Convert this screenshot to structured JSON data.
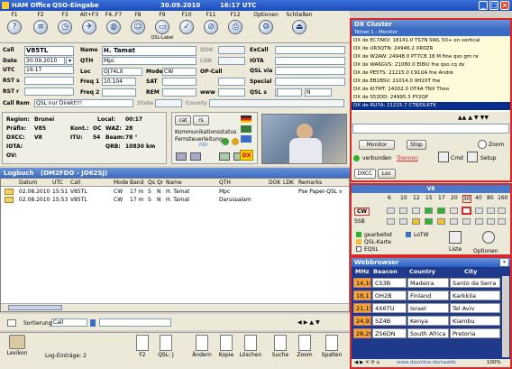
{
  "window": {
    "title": "HAM Office",
    "subtitle": "QSO-Eingabe",
    "date": "30.09.2010",
    "time": "16:17 UTC"
  },
  "toolbar": [
    {
      "key": "F1",
      "icon": "help-icon",
      "glyph": "?"
    },
    {
      "key": "F2",
      "icon": "log-icon",
      "glyph": "≡"
    },
    {
      "key": "F3",
      "icon": "clock-icon",
      "glyph": "◷"
    },
    {
      "key": "Alt+F3",
      "icon": "satellite-icon",
      "glyph": "✈"
    },
    {
      "key": "F4..F7",
      "icon": "globe-icon",
      "glyph": "◍"
    },
    {
      "key": "F8",
      "icon": "person-icon",
      "glyph": "☺"
    },
    {
      "key": "F9",
      "icon": "qsl-label-icon",
      "glyph": "▭",
      "label": "QSL-Label"
    },
    {
      "key": "F10",
      "icon": "check-icon",
      "glyph": "✓"
    },
    {
      "key": "F11",
      "icon": "cancel-icon",
      "glyph": "⊘"
    },
    {
      "key": "F12",
      "icon": "print-icon",
      "glyph": "⎙"
    },
    {
      "key": "Optionen",
      "icon": "options-icon",
      "glyph": "⚙"
    },
    {
      "key": "Schließen",
      "icon": "exit-icon",
      "glyph": "⏏"
    }
  ],
  "form": {
    "call_label": "Call",
    "call": "V85TL",
    "date_label": "Date",
    "date": "30.09.2010",
    "utc_label": "UTC",
    "utc": "16:17",
    "rst_s_label": "RST s",
    "rst_r_label": "RST r",
    "name_label": "Name",
    "name": "H. Tamat",
    "qth_label": "QTH",
    "qth": "Mpc",
    "loc_label": "Loc",
    "loc": "OJ74LX",
    "freq_label": "Freq 1",
    "freq": "10.104",
    "freq2_label": "Freq 2",
    "mode_label": "Mode",
    "mode": "CW",
    "sat_label": "SAT",
    "rem_label": "REM",
    "www_label": "www",
    "dok_label": "DOK",
    "ldk_label": "LDK",
    "excall_label": "ExCall",
    "iota_label": "IOTA",
    "qsl_via_label": "QSL via",
    "opcall_label": "OP-Call",
    "special_label": "Special",
    "qsl_s_label": "QSL s",
    "qsl_s_value": "J",
    "qsl_s_value2": "N",
    "state_label": "State",
    "county_label": "County",
    "call_rem_label": "Call Rem",
    "call_rem": "QSL nur Direkt!!!"
  },
  "info": {
    "region_label": "Region:",
    "region": "Brunei",
    "prefix_label": "Präfix:",
    "prefix": "V85",
    "dxcc_label": "DXCC:",
    "dxcc": "V8",
    "iota_label": "IOTA:",
    "ov_label": "OV:",
    "local_label": "Local:",
    "local": "00:17",
    "kont_label": "Kont.:",
    "kont": "OC",
    "itu_label": "ITU:",
    "itu": "54",
    "qrb_label": "QRB:",
    "qrb": "10830 km",
    "waz_label": "WAZ:",
    "waz": "28",
    "beam_label": "Beam:",
    "beam": "78 °",
    "tab_cat": "cat",
    "tab_rs": "rs",
    "kommunikation": "Kommunikationsstatus",
    "fernsteuer": "Fernsteuerleitung:",
    "fernsteuer_val": "nin",
    "dx_badge": "DX"
  },
  "log": {
    "title": "Logbuch",
    "subtitle": "(DM2FDO - JO62SJ)",
    "columns": [
      "Datum",
      "UTC",
      "Call",
      "Mode",
      "Band",
      "Qs",
      "Qr",
      "Name",
      "QTH",
      "DOK",
      "LDK",
      "Remarks"
    ],
    "rows": [
      [
        "02.08.2010",
        "15:51",
        "V85TL",
        "CW",
        "17 m",
        "S",
        "N",
        "H. Tamat",
        "Mpc",
        "",
        "",
        "Pse Paper-QSL v"
      ],
      [
        "02.08.2010",
        "15:53",
        "V85TL",
        "CW",
        "17 m",
        "S",
        "N",
        "H. Tamat",
        "Darussalam",
        "",
        "",
        ""
      ]
    ]
  },
  "sortbar": {
    "label": "Sortierung:",
    "value": "Call"
  },
  "bottom": {
    "lexikon": "Lexikon",
    "entries": "Log-Einträge: 2",
    "buttons": [
      "F2",
      "QSL: J",
      "Ändern",
      "Kopie",
      "Löschen",
      "Suche",
      "Zoom",
      "Spalten"
    ]
  },
  "dxcluster": {
    "title": "DX Cluster",
    "connection": "Telnet 1 - Monitor",
    "spots": [
      "DX de EC7AKV:  18141.0  TS7N   SWL 50+ on vertical",
      "DX de UR3QTN:  24946.2  XR0ZR",
      "DX de W2AW:   24948.0  PT7CB   18 M   fine qso gm ra",
      "DX de WA6GVS: 21080.0  EI8IU          fne qso cq dx",
      "DX de PE5TS:  21215.0  C91UA          fne André",
      "DX de EB1BSV: 21014.0  9H2XT   fne",
      "DX de KI7MT:  14202.0  OT4A   TNX Theo",
      "DX de S52DD:  24995.3  PY2QP",
      "DX de RU7A:   21215.7  CT8/DL6TK"
    ],
    "monitor": "Monitor",
    "stop": "Stop",
    "zoom": "Zoom",
    "status": "verbunden",
    "disconnect": "Trennen",
    "cmd": "Cmd",
    "setup": "Setup",
    "tab_dxcc": "DXCC",
    "tab_loc": "Loc"
  },
  "bands": {
    "call": "V8",
    "list": [
      "6",
      "10",
      "12",
      "15",
      "17",
      "20",
      "30",
      "40",
      "80",
      "160"
    ],
    "modes": [
      "CW",
      "SSB"
    ],
    "legend": [
      "gearbeitet",
      "QSL-Karte",
      "EQSL"
    ],
    "lotw": "LoTW",
    "list_label": "Liste",
    "options_label": "Optionen"
  },
  "web": {
    "title": "Webbrowser",
    "columns": [
      "MHz",
      "Beacon",
      "Country",
      "City"
    ],
    "rows": [
      [
        "14,100",
        "CS3B",
        "Madeira",
        "Santo da Serra"
      ],
      [
        "18,110",
        "OH2B",
        "Finland",
        "Karkkila"
      ],
      [
        "21,150",
        "4X6TU",
        "Israel",
        "Tel Aviv"
      ],
      [
        "24,930",
        "5Z4B",
        "Kenya",
        "Kiambu"
      ],
      [
        "28,200",
        "ZS6DN",
        "South Africa",
        "Pretoria"
      ]
    ],
    "url": "www.dxonline.de/nawtb",
    "zoom": "100%"
  },
  "colors": {
    "accent": "#2a5fc8",
    "red": "#d62a2a",
    "cluster_selected": "#0a2f8a",
    "mhz_bg": "#f3a633"
  }
}
